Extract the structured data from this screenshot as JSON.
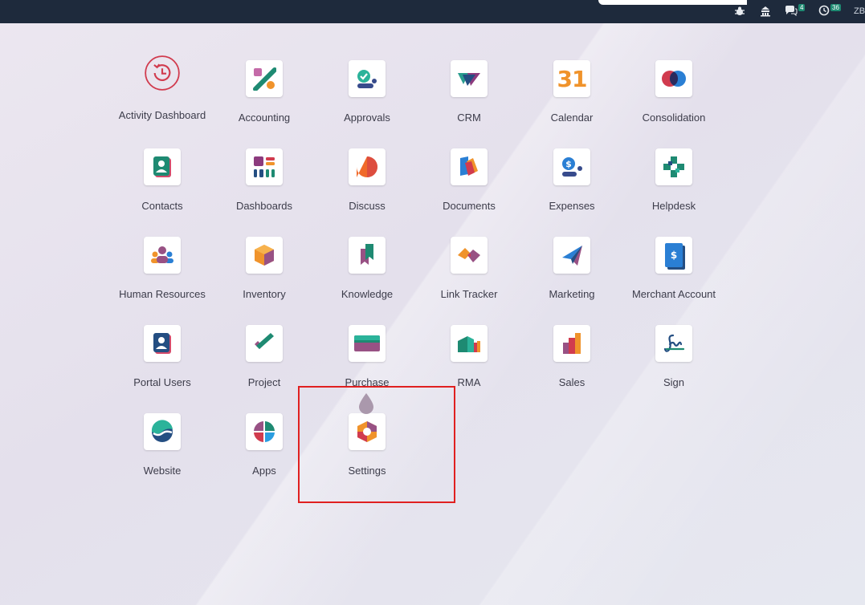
{
  "topbar": {
    "icons": [
      "bug-icon",
      "switch-company-icon",
      "messaging-icon",
      "activity-clock-icon"
    ],
    "messages_count": "4",
    "activities_count": "36",
    "user_initials": "ZB"
  },
  "apps": [
    {
      "name": "Activity Dashboard",
      "icon": "activity-dashboard-icon"
    },
    {
      "name": "Accounting",
      "icon": "accounting-icon"
    },
    {
      "name": "Approvals",
      "icon": "approvals-icon"
    },
    {
      "name": "CRM",
      "icon": "crm-icon"
    },
    {
      "name": "Calendar",
      "icon": "calendar-icon",
      "icon_text": "31"
    },
    {
      "name": "Consolidation",
      "icon": "consolidation-icon"
    },
    {
      "name": "Contacts",
      "icon": "contacts-icon"
    },
    {
      "name": "Dashboards",
      "icon": "dashboards-icon"
    },
    {
      "name": "Discuss",
      "icon": "discuss-icon"
    },
    {
      "name": "Documents",
      "icon": "documents-icon"
    },
    {
      "name": "Expenses",
      "icon": "expenses-icon"
    },
    {
      "name": "Helpdesk",
      "icon": "helpdesk-icon"
    },
    {
      "name": "Human Resources",
      "icon": "human-resources-icon"
    },
    {
      "name": "Inventory",
      "icon": "inventory-icon"
    },
    {
      "name": "Knowledge",
      "icon": "knowledge-icon"
    },
    {
      "name": "Link Tracker",
      "icon": "link-tracker-icon"
    },
    {
      "name": "Marketing",
      "icon": "marketing-icon"
    },
    {
      "name": "Merchant Account",
      "icon": "merchant-account-icon",
      "icon_text": "$"
    },
    {
      "name": "Portal Users",
      "icon": "portal-users-icon"
    },
    {
      "name": "Project",
      "icon": "project-icon"
    },
    {
      "name": "Purchase",
      "icon": "purchase-icon"
    },
    {
      "name": "RMA",
      "icon": "rma-icon"
    },
    {
      "name": "Sales",
      "icon": "sales-icon"
    },
    {
      "name": "Sign",
      "icon": "sign-icon"
    },
    {
      "name": "Website",
      "icon": "website-icon"
    },
    {
      "name": "Apps",
      "icon": "apps-icon"
    },
    {
      "name": "Settings",
      "icon": "settings-icon"
    }
  ],
  "colors": {
    "topbar": "#1e2a3c",
    "highlight": "#e02020",
    "accent_purple": "#985184",
    "accent_orange": "#f0932b",
    "accent_teal": "#1e8a72"
  }
}
